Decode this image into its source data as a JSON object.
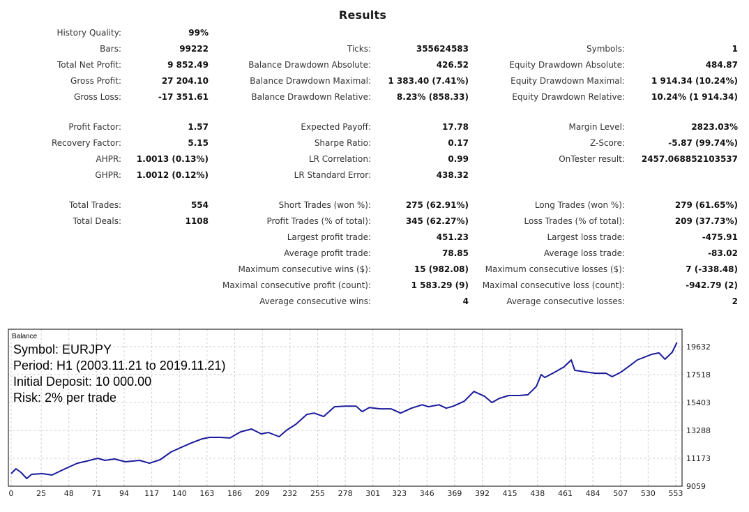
{
  "report": {
    "title": "Results",
    "sections": [
      {
        "rows": [
          [
            {
              "label": "History Quality:",
              "value": "99%"
            },
            null,
            null
          ],
          [
            {
              "label": "Bars:",
              "value": "99222"
            },
            {
              "label": "Ticks:",
              "value": "355624583"
            },
            {
              "label": "Symbols:",
              "value": "1"
            }
          ],
          [
            {
              "label": "Total Net Profit:",
              "value": "9 852.49"
            },
            {
              "label": "Balance Drawdown Absolute:",
              "value": "426.52"
            },
            {
              "label": "Equity Drawdown Absolute:",
              "value": "484.87"
            }
          ],
          [
            {
              "label": "Gross Profit:",
              "value": "27 204.10"
            },
            {
              "label": "Balance Drawdown Maximal:",
              "value": "1 383.40 (7.41%)"
            },
            {
              "label": "Equity Drawdown Maximal:",
              "value": "1 914.34 (10.24%)"
            }
          ],
          [
            {
              "label": "Gross Loss:",
              "value": "-17 351.61"
            },
            {
              "label": "Balance Drawdown Relative:",
              "value": "8.23% (858.33)"
            },
            {
              "label": "Equity Drawdown Relative:",
              "value": "10.24% (1 914.34)"
            }
          ]
        ]
      },
      {
        "rows": [
          [
            {
              "label": "Profit Factor:",
              "value": "1.57"
            },
            {
              "label": "Expected Payoff:",
              "value": "17.78"
            },
            {
              "label": "Margin Level:",
              "value": "2823.03%"
            }
          ],
          [
            {
              "label": "Recovery Factor:",
              "value": "5.15"
            },
            {
              "label": "Sharpe Ratio:",
              "value": "0.17"
            },
            {
              "label": "Z-Score:",
              "value": "-5.87 (99.74%)"
            }
          ],
          [
            {
              "label": "AHPR:",
              "value": "1.0013 (0.13%)"
            },
            {
              "label": "LR Correlation:",
              "value": "0.99"
            },
            {
              "label": "OnTester result:",
              "value": "2457.068852103537"
            }
          ],
          [
            {
              "label": "GHPR:",
              "value": "1.0012 (0.12%)"
            },
            {
              "label": "LR Standard Error:",
              "value": "438.32"
            },
            null
          ]
        ]
      },
      {
        "rows": [
          [
            {
              "label": "Total Trades:",
              "value": "554"
            },
            {
              "label": "Short Trades (won %):",
              "value": "275 (62.91%)"
            },
            {
              "label": "Long Trades (won %):",
              "value": "279 (61.65%)"
            }
          ],
          [
            {
              "label": "Total Deals:",
              "value": "1108"
            },
            {
              "label": "Profit Trades (% of total):",
              "value": "345 (62.27%)"
            },
            {
              "label": "Loss Trades (% of total):",
              "value": "209 (37.73%)"
            }
          ],
          [
            null,
            {
              "label": "Largest profit trade:",
              "value": "451.23"
            },
            {
              "label": "Largest loss trade:",
              "value": "-475.91"
            }
          ],
          [
            null,
            {
              "label": "Average profit trade:",
              "value": "78.85"
            },
            {
              "label": "Average loss trade:",
              "value": "-83.02"
            }
          ],
          [
            null,
            {
              "label": "Maximum consecutive wins ($):",
              "value": "15 (982.08)"
            },
            {
              "label": "Maximum consecutive losses ($):",
              "value": "7 (-338.48)"
            }
          ],
          [
            null,
            {
              "label": "Maximal consecutive profit (count):",
              "value": "1 583.29 (9)"
            },
            {
              "label": "Maximal consecutive loss (count):",
              "value": "-942.79 (2)"
            }
          ],
          [
            null,
            {
              "label": "Average consecutive wins:",
              "value": "4"
            },
            {
              "label": "Average consecutive losses:",
              "value": "2"
            }
          ]
        ]
      }
    ]
  },
  "chart_data": {
    "type": "line",
    "title": "Balance",
    "annotations": [
      "Symbol: EURJPY",
      "Period: H1 (2003.11.21 to 2019.11.21)",
      "Initial Deposit: 10 000.00",
      "Risk: 2% per trade"
    ],
    "xlabel": "",
    "ylabel": "",
    "x_ticks": [
      0,
      25,
      48,
      71,
      94,
      117,
      140,
      163,
      186,
      209,
      232,
      255,
      278,
      301,
      323,
      346,
      369,
      392,
      415,
      438,
      461,
      484,
      507,
      530,
      553
    ],
    "y_ticks": [
      9059,
      11173,
      13288,
      15403,
      17518,
      19632
    ],
    "xlim": [
      0,
      560
    ],
    "ylim": [
      9059,
      20650
    ],
    "grid": true,
    "line_color": "#1a1a9c",
    "series": [
      {
        "name": "Balance",
        "x": [
          0,
          4,
          8,
          13,
          17,
          26,
          34,
          40,
          46,
          55,
          63,
          72,
          78,
          86,
          95,
          107,
          115,
          124,
          133,
          142,
          150,
          159,
          165,
          174,
          182,
          191,
          200,
          208,
          214,
          223,
          229,
          237,
          246,
          252,
          260,
          269,
          278,
          287,
          292,
          298,
          307,
          316,
          324,
          333,
          342,
          347,
          356,
          362,
          368,
          377,
          385,
          394,
          400,
          406,
          414,
          423,
          430,
          437,
          441,
          444,
          452,
          460,
          466,
          469,
          477,
          486,
          495,
          500,
          507,
          515,
          521,
          527,
          533,
          539,
          544,
          550,
          554
        ],
        "values": [
          10013,
          10380,
          10115,
          9640,
          9958,
          10010,
          9905,
          10170,
          10430,
          10800,
          10960,
          11173,
          11015,
          11120,
          10910,
          11015,
          10800,
          11070,
          11650,
          12020,
          12340,
          12650,
          12760,
          12760,
          12710,
          13180,
          13395,
          13025,
          13130,
          12810,
          13290,
          13760,
          14500,
          14600,
          14340,
          15080,
          15130,
          15130,
          14710,
          15020,
          14920,
          14920,
          14600,
          14970,
          15230,
          15080,
          15230,
          14970,
          15130,
          15500,
          16240,
          15870,
          15400,
          15710,
          15930,
          15930,
          15990,
          16620,
          17520,
          17300,
          17680,
          18100,
          18630,
          17840,
          17730,
          17620,
          17620,
          17360,
          17680,
          18210,
          18630,
          18840,
          19050,
          19160,
          18680,
          19210,
          19950
        ]
      }
    ]
  }
}
